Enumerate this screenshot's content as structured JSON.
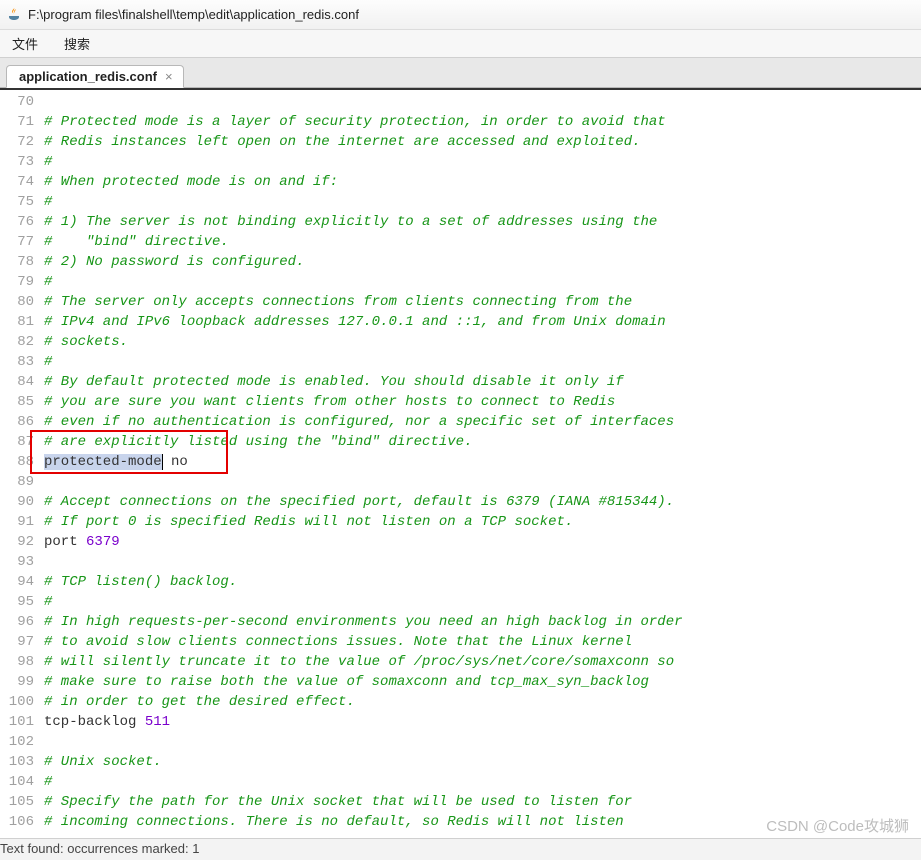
{
  "titlebar": {
    "path": "F:\\program files\\finalshell\\temp\\edit\\application_redis.conf"
  },
  "menubar": {
    "file": "文件",
    "search": "搜索"
  },
  "tab": {
    "label": "application_redis.conf",
    "close": "×"
  },
  "gutter": {
    "start": 70,
    "end": 106
  },
  "lines": {
    "l70": "",
    "l71": "# Protected mode is a layer of security protection, in order to avoid that",
    "l72": "# Redis instances left open on the internet are accessed and exploited.",
    "l73": "#",
    "l74": "# When protected mode is on and if:",
    "l75": "#",
    "l76": "# 1) The server is not binding explicitly to a set of addresses using the",
    "l77": "#    \"bind\" directive.",
    "l78": "# 2) No password is configured.",
    "l79": "#",
    "l80": "# The server only accepts connections from clients connecting from the",
    "l81": "# IPv4 and IPv6 loopback addresses 127.0.0.1 and ::1, and from Unix domain",
    "l82": "# sockets.",
    "l83": "#",
    "l84": "# By default protected mode is enabled. You should disable it only if",
    "l85": "# you are sure you want clients from other hosts to connect to Redis",
    "l86": "# even if no authentication is configured, nor a specific set of interfaces",
    "l87": "# are explicitly listed using the \"bind\" directive.",
    "l88_key": "protected-mode",
    "l88_val": " no",
    "l89": "",
    "l90": "# Accept connections on the specified port, default is 6379 (IANA #815344).",
    "l91": "# If port 0 is specified Redis will not listen on a TCP socket.",
    "l92_key": "port ",
    "l92_val": "6379",
    "l93": "",
    "l94": "# TCP listen() backlog.",
    "l95": "#",
    "l96": "# In high requests-per-second environments you need an high backlog in order",
    "l97": "# to avoid slow clients connections issues. Note that the Linux kernel",
    "l98": "# will silently truncate it to the value of /proc/sys/net/core/somaxconn so",
    "l99": "# make sure to raise both the value of somaxconn and tcp_max_syn_backlog",
    "l100": "# in order to get the desired effect.",
    "l101_key": "tcp-backlog ",
    "l101_val": "511",
    "l102": "",
    "l103": "# Unix socket.",
    "l104": "#",
    "l105": "# Specify the path for the Unix socket that will be used to listen for",
    "l106": "# incoming connections. There is no default, so Redis will not listen"
  },
  "status": {
    "text": "Text found: occurrences marked: 1"
  },
  "watermark": {
    "text": "CSDN @Code攻城狮"
  }
}
